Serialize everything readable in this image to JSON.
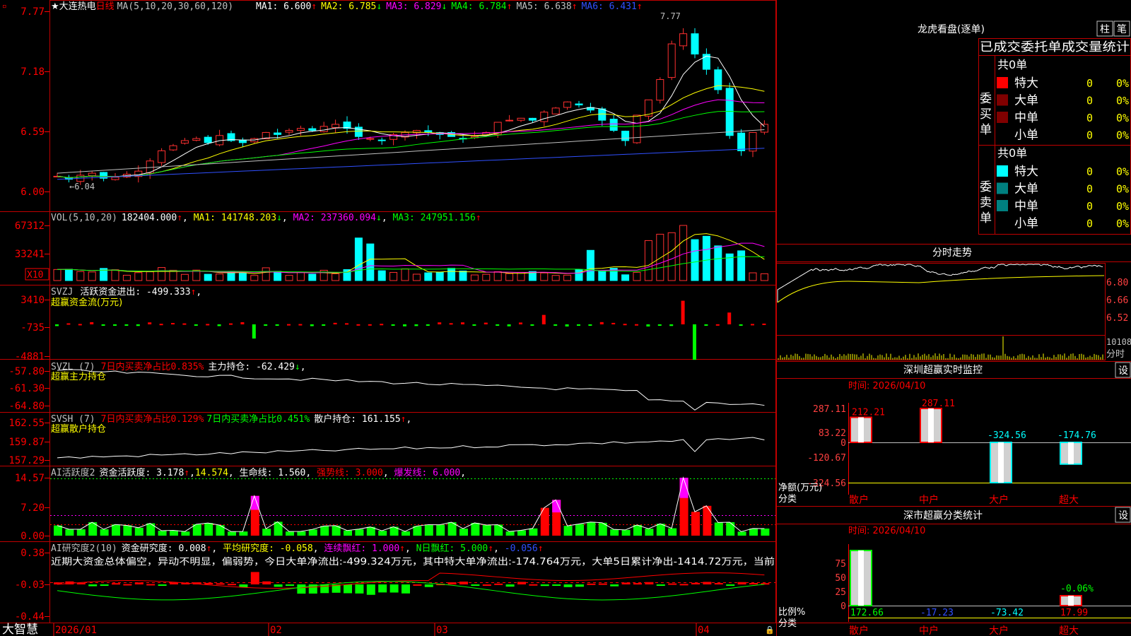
{
  "brand": "大智慧",
  "stock_title": "★大连热电",
  "period": "日线",
  "lock_icon": "lock-icon",
  "panels": {
    "kline": {
      "name": "MA(5,10,20,30,60,120)",
      "ma": [
        {
          "label": "MA1: 6.600",
          "arrow": "↑",
          "color": "#ffffff"
        },
        {
          "label": "MA2: 6.785",
          "arrow": "↓",
          "color": "#ffff00"
        },
        {
          "label": "MA3: 6.829",
          "arrow": "↓",
          "color": "#ff00ff"
        },
        {
          "label": "MA4: 6.784",
          "arrow": "↑",
          "color": "#00ff00"
        },
        {
          "label": "MA5: 6.638",
          "arrow": "↑",
          "color": "#c0c0c0"
        },
        {
          "label": "MA6: 6.431",
          "arrow": "↑",
          "color": "#3050ff"
        }
      ],
      "yticks": [
        "7.77",
        "7.18",
        "6.59",
        "6.00"
      ],
      "high_label": "7.77",
      "low_label": "6.04"
    },
    "vol": {
      "name": "VOL(5,10,20)",
      "value": "182404.000",
      "ma": [
        {
          "label": "MA1: 141748.203",
          "arrow": "↓",
          "color": "#ffff00"
        },
        {
          "label": "MA2: 237360.094",
          "arrow": "↓",
          "color": "#ff00ff"
        },
        {
          "label": "MA3: 247951.156",
          "arrow": "↑",
          "color": "#00ff00"
        }
      ],
      "yticks": [
        "67312",
        "33241"
      ],
      "unit": "X10"
    },
    "svzj": {
      "name": "SVZJ",
      "line1": "活跃资金进出: -499.333",
      "arrow": "↑",
      "sub": "超赢资金流(万元)",
      "yticks": [
        "3410",
        "-735",
        "-4881"
      ]
    },
    "svzl": {
      "name": "SVZL (7)",
      "desc": "7日内买卖净占比0.835%",
      "line2": "主力持仓: -62.429",
      "arrow": "↓",
      "sub": "超赢主力持仓",
      "yticks": [
        "-57.80",
        "-61.30",
        "-64.80"
      ]
    },
    "svsh": {
      "name": "SVSH (7)",
      "desc1": "7日内买卖净占比0.129%",
      "desc2": "7日内买卖净占比0.451%",
      "line3": "散户持仓: 161.155",
      "arrow": "↑",
      "sub": "超赢散户持仓",
      "yticks": [
        "162.55",
        "159.87",
        "157.29"
      ]
    },
    "ai1": {
      "name": "AI活跃度2",
      "l1": "资金活跃度: 3.178",
      "l2": "14.574",
      "l3": "生命线: 1.560",
      "l4": "强势线: 3.000",
      "l5": "爆发线: 6.000",
      "yticks": [
        "14.57",
        "7.20",
        "0.00"
      ]
    },
    "ai2": {
      "name": "AI研究度2(10)",
      "l1": "资金研究度: 0.008",
      "l2": "平均研究度: -0.058",
      "l3": "连续飘红: 1.000",
      "l4": "N日飘红: 5.000",
      "l5": "-0.056",
      "comment": "近期大资金总体偏空，异动不明显，偏弱势，今日大单净流出:-499.324万元，其中特大单净流出:-174.764万元，大单5日累计净出-1414.72万元，当前",
      "yticks": [
        "0.38",
        "-0.03",
        "-0.44"
      ]
    }
  },
  "date_axis": [
    "2026/01",
    "02",
    "03",
    "04"
  ],
  "right": {
    "lhb_title": "龙虎看盘(逐单)",
    "btn_zhu": "柱",
    "btn_bi": "笔",
    "trade_header": "已成交委托单成交量统计",
    "buy": {
      "side": "委买单",
      "total": "共0单",
      "rows": [
        {
          "label": "特大",
          "val": "0",
          "pct": "0%",
          "color": "#ff0000"
        },
        {
          "label": "大单",
          "val": "0",
          "pct": "0%",
          "color": "#800000"
        },
        {
          "label": "中单",
          "val": "0",
          "pct": "0%",
          "color": "#800000"
        },
        {
          "label": "小单",
          "val": "0",
          "pct": "0%",
          "color": ""
        }
      ]
    },
    "sell": {
      "side": "委卖单",
      "total": "共0单",
      "rows": [
        {
          "label": "特大",
          "val": "0",
          "pct": "0%",
          "color": "#00ffff"
        },
        {
          "label": "大单",
          "val": "0",
          "pct": "0%",
          "color": "#008080"
        },
        {
          "label": "中单",
          "val": "0",
          "pct": "0%",
          "color": "#008080"
        },
        {
          "label": "小单",
          "val": "0",
          "pct": "0%",
          "color": ""
        }
      ]
    },
    "intraday_title": "分时走势",
    "intraday_yticks": [
      "6.80",
      "6.66",
      "6.52"
    ],
    "intraday_vol": "10108",
    "intraday_vol2": "分时",
    "monitor": {
      "title": "深圳超赢实时监控",
      "settings": "设",
      "time": "时间: 2026/04/10",
      "yticks": [
        "287.11",
        "83.22",
        "0",
        "-120.67",
        "-324.56"
      ],
      "ylabel1": "净额(万元)",
      "ylabel2": "分类",
      "cats": [
        "散户",
        "中户",
        "大户",
        "超大"
      ],
      "values": [
        212.21,
        287.11,
        -324.56,
        -174.76
      ],
      "labels": [
        "212.21",
        "287.11",
        "-324.56",
        "-174.76"
      ]
    },
    "classify": {
      "title": "深市超赢分类统计",
      "settings": "设",
      "time": "时间: 2026/04/10",
      "yticks": [
        "75",
        "50",
        "25",
        "0"
      ],
      "ylabel1": "比例%",
      "ylabel2": "分类",
      "cats": [
        "散户",
        "中户",
        "大户",
        "超大"
      ],
      "bars": [
        100,
        0,
        0,
        17.99
      ],
      "bottom": [
        "172.66",
        "-17.23",
        "-73.42",
        "17.99"
      ],
      "extra": "-0.06%"
    }
  }
}
